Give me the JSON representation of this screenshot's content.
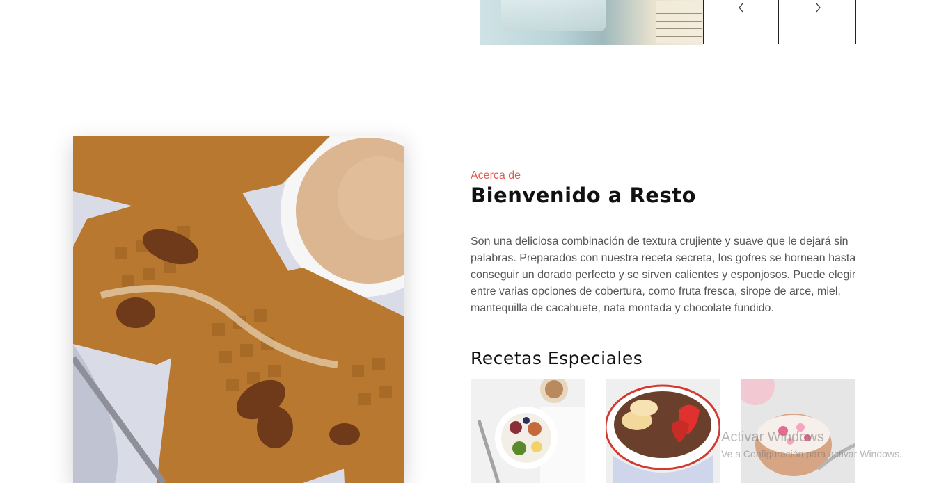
{
  "slider": {
    "prev_icon": "chevron-left-icon",
    "next_icon": "chevron-right-icon"
  },
  "about": {
    "eyebrow": "Acerca de",
    "title": "Bienvenido a Resto",
    "description": "Son una deliciosa combinación de textura crujiente y suave que le dejará sin palabras. Preparados con nuestra receta secreta, los gofres se hornean hasta conseguir un dorado perfecto y se sirven calientes y esponjosos. Puede elegir entre varias opciones de cobertura, como fruta fresca, sirope de arce, miel, mantequilla de cacahuete, nata montada y chocolate fundido."
  },
  "special_recipes": {
    "title": "Recetas Especiales"
  },
  "os_watermark": {
    "line1": "Activar Windows",
    "line2": "Ve a Configuración para activar Windows."
  },
  "colors": {
    "accent": "#e05a4f",
    "heading": "#111111",
    "body": "#555555"
  }
}
